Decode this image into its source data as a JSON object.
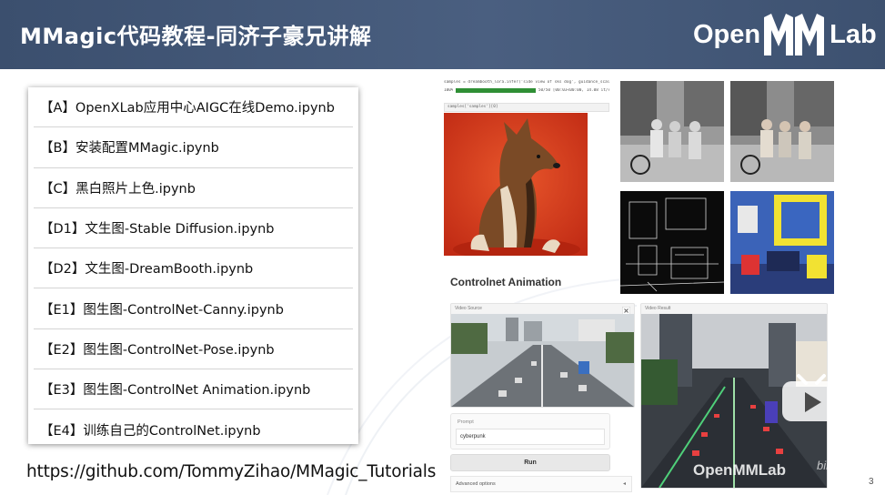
{
  "header": {
    "title": "MMagic代码教程-同济子豪兄讲解",
    "logo_left": "Open",
    "logo_right": "Lab",
    "colors": {
      "bar": "#3f5474",
      "text": "#ffffff"
    }
  },
  "files": [
    "【A】OpenXLab应用中心AIGC在线Demo.ipynb",
    "【B】安装配置MMagic.ipynb",
    "【C】黑白照片上色.ipynb",
    "【D1】文生图-Stable Diffusion.ipynb",
    "【D2】文生图-DreamBooth.ipynb",
    "【E1】图生图-ControlNet-Canny.ipynb",
    "【E2】图生图-ControlNet-Pose.ipynb",
    "【E3】图生图-ControlNet Animation.ipynb",
    "【E4】训练自己的ControlNet.ipynb"
  ],
  "repo_url": "https://github.com/TommyZihao/MMagic_Tutorials",
  "notebook": {
    "code_line": "samples = dreambooth_lora.infer('side view of sks dog', guidance_scale=2)",
    "progress_label": "100%",
    "progress_stats": "50/50 [00:03<00:00, 14.08 it/s]",
    "progress": 1.0,
    "cell2_line": "samples['samples'][0]"
  },
  "animation": {
    "title": "Controlnet Animation",
    "video_source_label": "Video Source",
    "video_result_label": "Video Result",
    "prompt_label": "Prompt",
    "prompt_value": "cyberpunk",
    "run_label": "Run",
    "advanced_label": "Advanced options",
    "advanced_arrow": "◂"
  },
  "watermark": "OpenMMLab",
  "watermark_site": "bilibili",
  "page_number": "3",
  "icons": [
    "openmmlab-logo-icon",
    "play-icon",
    "close-icon",
    "chevron-left-icon"
  ]
}
